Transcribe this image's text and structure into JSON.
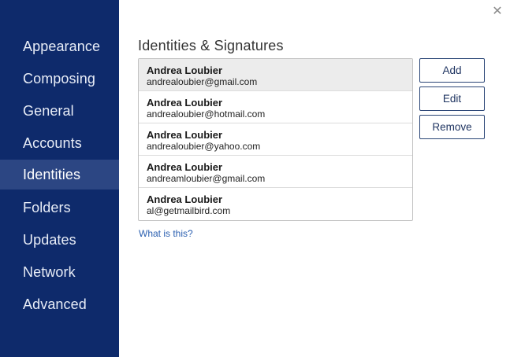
{
  "sidebar": {
    "items": [
      {
        "label": "Appearance",
        "active": false
      },
      {
        "label": "Composing",
        "active": false
      },
      {
        "label": "General",
        "active": false
      },
      {
        "label": "Accounts",
        "active": false
      },
      {
        "label": "Identities",
        "active": true
      },
      {
        "label": "Folders",
        "active": false
      },
      {
        "label": "Updates",
        "active": false
      },
      {
        "label": "Network",
        "active": false
      },
      {
        "label": "Advanced",
        "active": false
      }
    ]
  },
  "window": {
    "close_glyph": "✕"
  },
  "main": {
    "title": "Identities & Signatures",
    "identities": [
      {
        "name": "Andrea Loubier",
        "email": "andrealoubier@gmail.com",
        "selected": true
      },
      {
        "name": "Andrea Loubier",
        "email": "andrealoubier@hotmail.com",
        "selected": false
      },
      {
        "name": "Andrea Loubier",
        "email": "andrealoubier@yahoo.com",
        "selected": false
      },
      {
        "name": "Andrea Loubier",
        "email": "andreamloubier@gmail.com",
        "selected": false
      },
      {
        "name": "Andrea Loubier",
        "email": "al@getmailbird.com",
        "selected": false
      }
    ],
    "buttons": {
      "add": "Add",
      "edit": "Edit",
      "remove": "Remove"
    },
    "help_link": "What is this?"
  },
  "colors": {
    "sidebar_bg": "#0e2a6b",
    "sidebar_active": "#2c4683",
    "accent": "#2a5fb0"
  }
}
